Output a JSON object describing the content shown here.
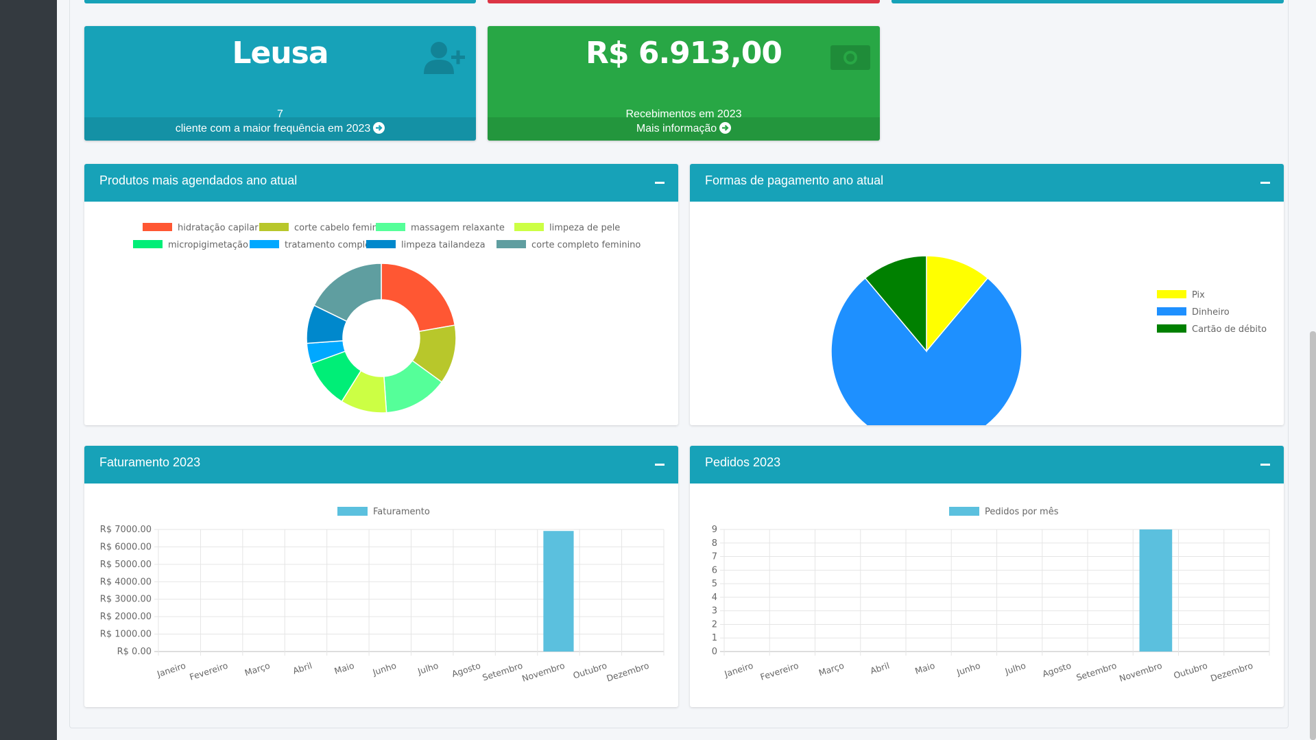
{
  "cards": {
    "top_client": {
      "value": "Leusa",
      "count": "7",
      "footer": "cliente com a maior frequência em 2023",
      "color": "#17a2b8"
    },
    "receipts": {
      "value": "R$ 6.913,00",
      "label": "Recebimentos em 2023",
      "footer": "Mais informação",
      "color": "#28a745"
    }
  },
  "top_strips": {
    "colors": [
      "#17a2b8",
      "#dc3545",
      "#17a2b8"
    ]
  },
  "panels": {
    "products": {
      "title": "Produtos mais agendados ano atual"
    },
    "payments": {
      "title": "Formas de pagamento ano atual"
    },
    "revenue": {
      "title": "Faturamento 2023"
    },
    "orders": {
      "title": "Pedidos 2023"
    }
  },
  "icons": {
    "user_plus": "user-plus-icon",
    "money": "money-bill-icon",
    "arrow": "arrow-circle-right-icon",
    "collapse": "minus-icon"
  },
  "chart_data": [
    {
      "id": "products",
      "type": "pie",
      "variant": "doughnut",
      "title": "",
      "categories": [
        "hidratação capilar",
        "corte cabelo feminino",
        "massagem relaxante",
        "limpeza de pele",
        "micropigimetação",
        "tratamento completo",
        "limpeza tailandeza",
        "corte completo feminino"
      ],
      "values": [
        2,
        1.15,
        1.25,
        0.9,
        0.95,
        0.4,
        0.75,
        1.6
      ],
      "colors": [
        "#ff5733",
        "#b8c72b",
        "#55ff99",
        "#ccff44",
        "#00ee77",
        "#00a8ff",
        "#0088cc",
        "#5f9ea0"
      ],
      "legend": "top"
    },
    {
      "id": "payments",
      "type": "pie",
      "title": "",
      "categories": [
        "Pix",
        "Dinheiro",
        "Cartão de débito"
      ],
      "values": [
        1,
        7,
        1
      ],
      "colors": [
        "#ffff00",
        "#1e90ff",
        "#008000"
      ],
      "legend": "right"
    },
    {
      "id": "revenue",
      "type": "bar",
      "title": "",
      "categories": [
        "Janeiro",
        "Fevereiro",
        "Março",
        "Abril",
        "Maio",
        "Junho",
        "Julho",
        "Agosto",
        "Setembro",
        "Novembro",
        "Outubro",
        "Dezembro"
      ],
      "series": [
        {
          "name": "Faturamento",
          "values": [
            0,
            0,
            0,
            0,
            0,
            0,
            0,
            0,
            0,
            6913,
            0,
            0
          ],
          "color": "#5bc0de"
        }
      ],
      "yticks": [
        "R$ 0.00",
        "R$ 1000.00",
        "R$ 2000.00",
        "R$ 3000.00",
        "R$ 4000.00",
        "R$ 5000.00",
        "R$ 6000.00",
        "R$ 7000.00"
      ],
      "ylim": [
        0,
        7000
      ],
      "grid": true,
      "legend": "top"
    },
    {
      "id": "orders",
      "type": "bar",
      "title": "",
      "categories": [
        "Janeiro",
        "Fevereiro",
        "Março",
        "Abril",
        "Maio",
        "Junho",
        "Julho",
        "Agosto",
        "Setembro",
        "Novembro",
        "Outubro",
        "Dezembro"
      ],
      "series": [
        {
          "name": "Pedidos por mês",
          "values": [
            0,
            0,
            0,
            0,
            0,
            0,
            0,
            0,
            0,
            9,
            0,
            0
          ],
          "color": "#5bc0de"
        }
      ],
      "yticks": [
        "0",
        "1",
        "2",
        "3",
        "4",
        "5",
        "6",
        "7",
        "8",
        "9"
      ],
      "ylim": [
        0,
        9
      ],
      "grid": true,
      "legend": "top"
    }
  ]
}
